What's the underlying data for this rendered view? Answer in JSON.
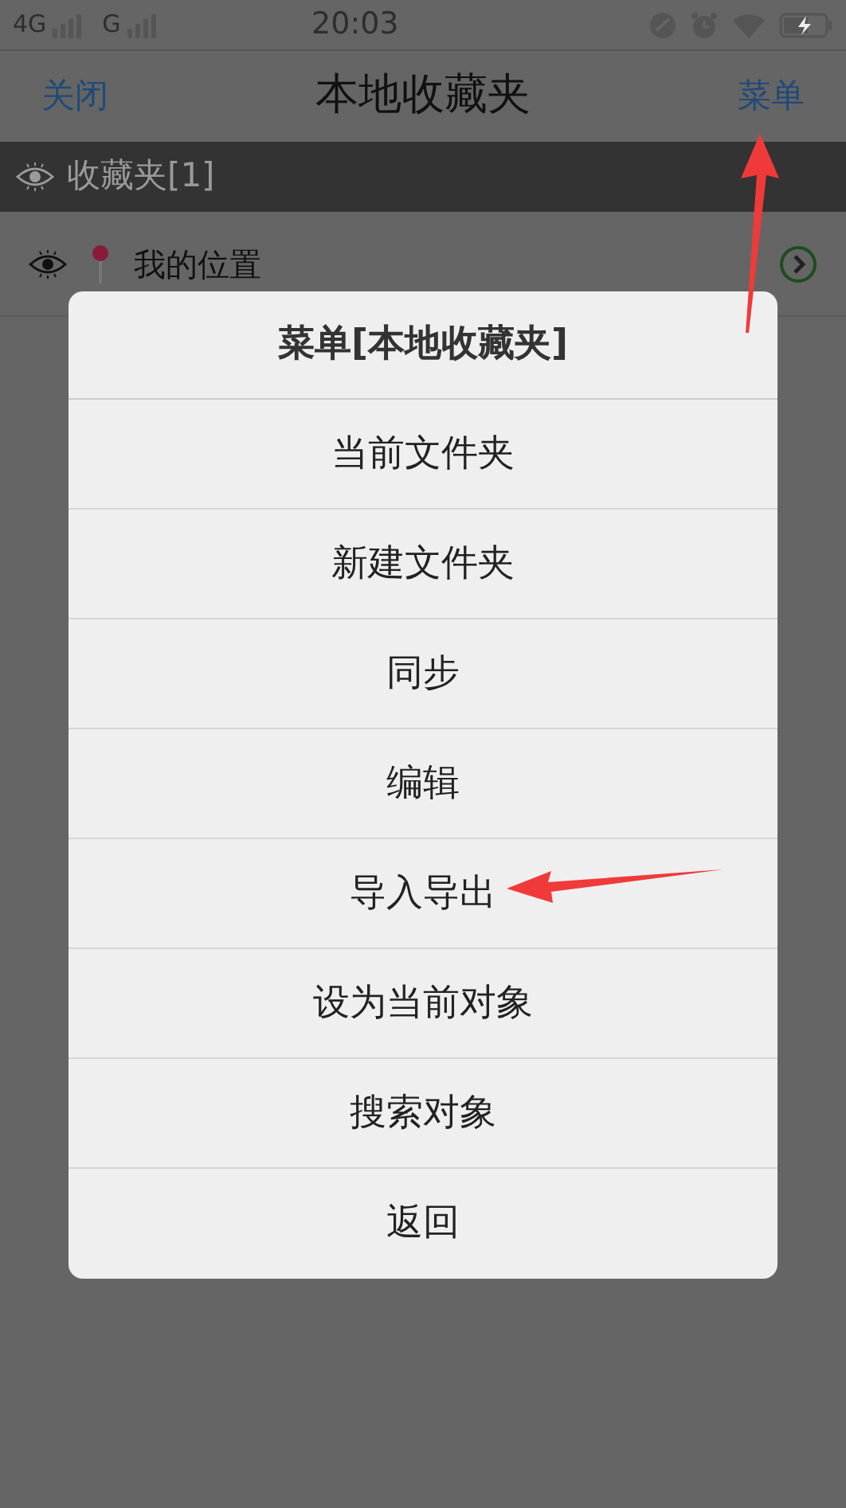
{
  "status_bar": {
    "network_1": "4G",
    "network_2": "G",
    "time": "20:03"
  },
  "header": {
    "left_button": "关闭",
    "title": "本地收藏夹",
    "right_button": "菜单"
  },
  "section": {
    "title": "收藏夹[1]"
  },
  "items": [
    {
      "label": "我的位置"
    }
  ],
  "menu": {
    "title": "菜单[本地收藏夹]",
    "items": [
      "当前文件夹",
      "新建文件夹",
      "同步",
      "编辑",
      "导入导出",
      "设为当前对象",
      "搜索对象",
      "返回"
    ]
  }
}
